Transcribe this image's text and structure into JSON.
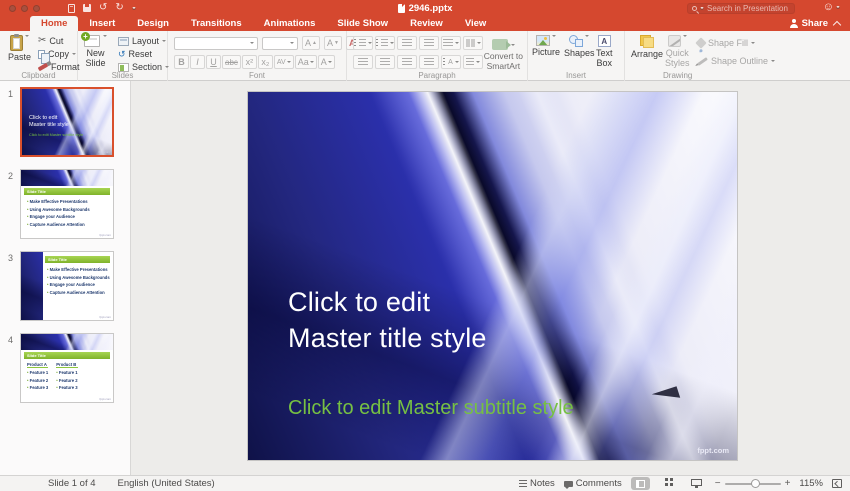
{
  "titlebar": {
    "title": "2946.pptx",
    "search_placeholder": "Search in Presentation",
    "share": "Share"
  },
  "tabs": {
    "home": "Home",
    "insert": "Insert",
    "design": "Design",
    "transitions": "Transitions",
    "animations": "Animations",
    "slideshow": "Slide Show",
    "review": "Review",
    "view": "View"
  },
  "ribbon": {
    "clipboard": {
      "label": "Clipboard",
      "paste": "Paste",
      "cut": "Cut",
      "copy": "Copy",
      "format": "Format"
    },
    "slides": {
      "label": "Slides",
      "new_slide_1": "New",
      "new_slide_2": "Slide",
      "layout": "Layout",
      "reset": "Reset",
      "section": "Section"
    },
    "font": {
      "label": "Font",
      "bold": "B",
      "italic": "I",
      "underline": "U",
      "strike": "abc",
      "sup": "x²",
      "sub": "x₂",
      "spacing": "AV",
      "case": "Aa",
      "color": "A",
      "grow": "A",
      "shrink": "A"
    },
    "paragraph": {
      "label": "Paragraph",
      "convert_1": "Convert to",
      "convert_2": "SmartArt"
    },
    "insert": {
      "label": "Insert",
      "picture": "Picture",
      "shapes": "Shapes",
      "textbox_1": "Text",
      "textbox_2": "Box"
    },
    "drawing": {
      "label": "Drawing",
      "arrange": "Arrange",
      "quick_1": "Quick",
      "quick_2": "Styles",
      "shape_fill": "Shape Fill",
      "shape_outline": "Shape Outline"
    }
  },
  "thumbnails": {
    "s1": {
      "number": "1",
      "title_1": "Click to edit",
      "title_2": "Master title style",
      "subtitle": "Click to edit Master subtitle style"
    },
    "s2": {
      "number": "2",
      "title": "Slide Title",
      "bullets": [
        "Make Effective Presentations",
        "Using Awesome Backgrounds",
        "Engage your Audience",
        "Capture Audience Attention"
      ]
    },
    "s3": {
      "number": "3",
      "title": "Slide Title",
      "bullets": [
        "Make Effective Presentations",
        "Using Awesome Backgrounds",
        "Engage your Audience",
        "Capture Audience Attention"
      ]
    },
    "s4": {
      "number": "4",
      "title": "Slide Title",
      "col_a": {
        "header": "Product A",
        "features": [
          "Feature 1",
          "Feature 2",
          "Feature 3"
        ]
      },
      "col_b": {
        "header": "Product B",
        "features": [
          "Feature 1",
          "Feature 2",
          "Feature 3"
        ]
      }
    }
  },
  "slide": {
    "title_1": "Click to edit",
    "title_2": "Master title style",
    "subtitle": "Click to edit Master subtitle style",
    "watermark": "fppt.com"
  },
  "statusbar": {
    "slide_info": "Slide 1 of 4",
    "language": "English (United States)",
    "notes": "Notes",
    "comments": "Comments",
    "zoom_level": "115%"
  },
  "colors": {
    "titlebar_red": "#d5482f",
    "selection_orange": "#d9502c",
    "slide_blue": "#2b30ad",
    "subtitle_green": "#76c043",
    "thumb_title_bar_green": "#8dc63f"
  }
}
